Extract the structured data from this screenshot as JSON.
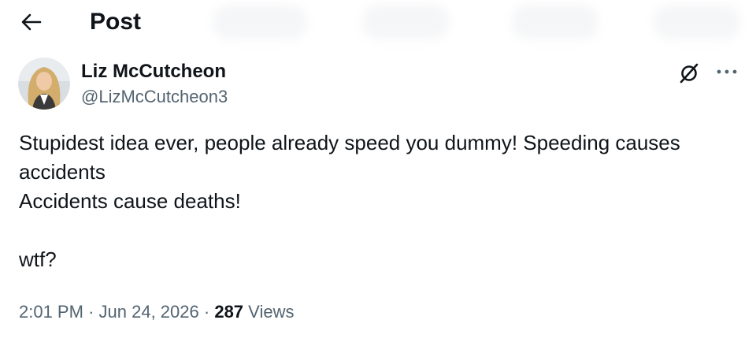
{
  "header": {
    "title": "Post"
  },
  "author": {
    "name": "Liz McCutcheon",
    "handle": "@LizMcCutcheon3"
  },
  "post": {
    "lines": [
      "Stupidest idea ever, people already speed you dummy! Speeding causes",
      "accidents",
      "Accidents cause deaths!",
      "",
      "wtf?"
    ]
  },
  "meta": {
    "time": "2:01 PM",
    "sep1": "·",
    "date": "Jun 24, 2026",
    "sep2": "·",
    "views_count": "287",
    "views_label": "Views"
  },
  "icons": {
    "back": "arrow-left-icon",
    "grok": "grok-icon",
    "more": "more-horizontal-icon"
  },
  "colors": {
    "text_primary": "#0f1419",
    "text_secondary": "#536471",
    "background": "#ffffff"
  }
}
